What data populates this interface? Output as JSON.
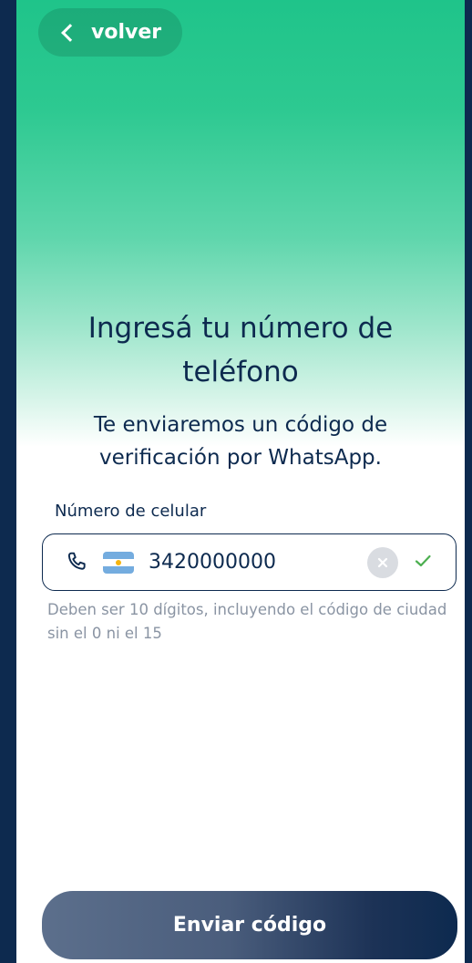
{
  "header": {
    "back_label": "volver"
  },
  "main": {
    "title": "Ingresá tu número de teléfono",
    "subtitle": "Te enviaremos un código de verificación por WhatsApp.",
    "field_label": "Número de celular",
    "phone_value": "3420000000",
    "country_flag": "Argentina",
    "helper_text": "Deben ser 10 dígitos, incluyendo el código de ciudad sin el 0 ni el 15"
  },
  "footer": {
    "submit_label": "Enviar código"
  },
  "icons": {
    "back": "chevron-left-icon",
    "phone": "phone-icon",
    "flag": "argentina-flag-icon",
    "clear": "close-icon",
    "valid": "check-icon"
  },
  "colors": {
    "primary_green": "#1fc48a",
    "navy": "#0d2a4f",
    "valid_check": "#4caf50",
    "helper_gray": "#8a94a3"
  }
}
